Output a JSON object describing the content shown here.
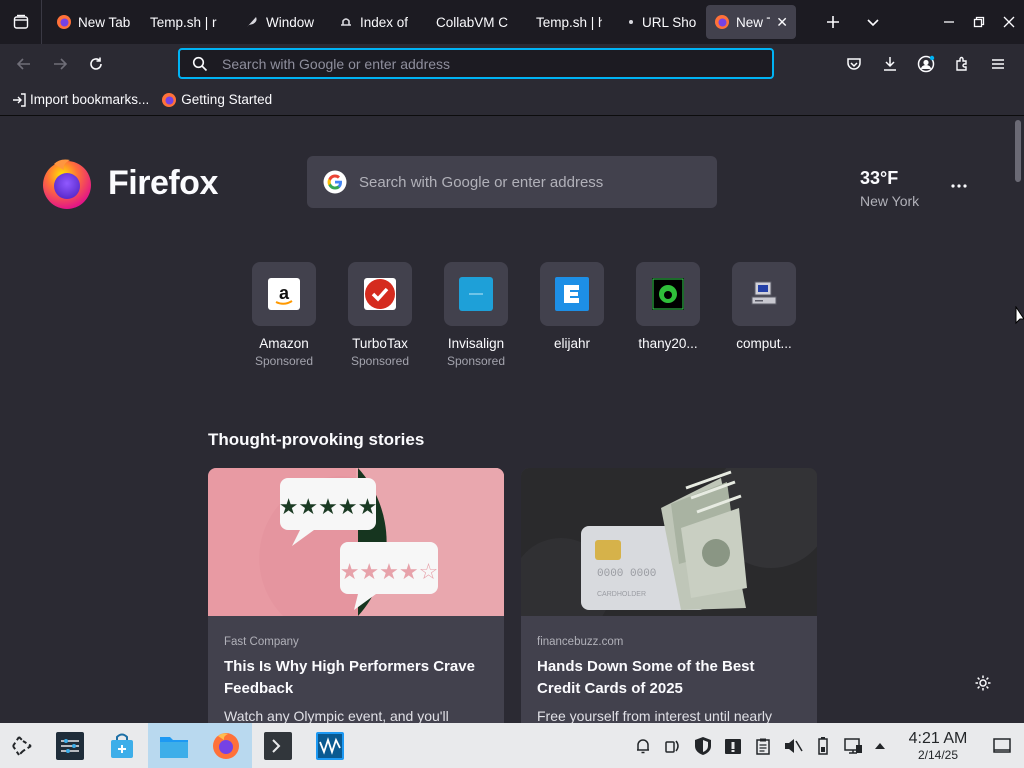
{
  "window": {
    "tabs": [
      {
        "label": "New Tab",
        "icon": "firefox-icon",
        "active": false
      },
      {
        "label": "Temp.sh | r",
        "icon": "none",
        "active": false
      },
      {
        "label": "Window",
        "icon": "feather-icon",
        "active": false
      },
      {
        "label": "Index of",
        "icon": "hat-icon",
        "active": false
      },
      {
        "label": "CollabVM Cl",
        "icon": "none",
        "active": false
      },
      {
        "label": "Temp.sh | h",
        "icon": "none",
        "active": false
      },
      {
        "label": "URL Sho",
        "icon": "link-icon",
        "active": false
      },
      {
        "label": "New T",
        "icon": "firefox-icon",
        "active": true
      }
    ]
  },
  "navbar": {
    "url_placeholder": "Search with Google or enter address"
  },
  "bookmarks": {
    "items": [
      {
        "label": "Import bookmarks...",
        "icon": "import-icon"
      },
      {
        "label": "Getting Started",
        "icon": "firefox-icon"
      }
    ]
  },
  "newtab": {
    "brand": "Firefox",
    "search_placeholder": "Search with Google or enter address",
    "weather": {
      "temp": "33°F",
      "city": "New York"
    },
    "top_sites": [
      {
        "name": "Amazon",
        "sponsor": "Sponsored",
        "icon": "amazon-icon"
      },
      {
        "name": "TurboTax",
        "sponsor": "Sponsored",
        "icon": "turbotax-icon"
      },
      {
        "name": "Invisalign",
        "sponsor": "Sponsored",
        "icon": "invisalign-icon"
      },
      {
        "name": "elijahr",
        "sponsor": "",
        "icon": "elijahr-icon"
      },
      {
        "name": "thany20...",
        "sponsor": "",
        "icon": "green-eye-icon"
      },
      {
        "name": "comput...",
        "sponsor": "",
        "icon": "computer-icon"
      }
    ],
    "section_title": "Thought-provoking stories",
    "stories": [
      {
        "source": "Fast Company",
        "title_line1": "This Is Why High Performers Crave",
        "title_line2": "Feedback",
        "excerpt": "Watch any Olympic event, and you'll",
        "image": "rating-speech-bubbles"
      },
      {
        "source": "financebuzz.com",
        "title_line1": "Hands Down Some of the Best",
        "title_line2": "Credit Cards of 2025",
        "excerpt": "Free yourself from interest until nearly",
        "image": "credit-card-cash"
      }
    ]
  },
  "taskbar": {
    "time": "4:21 AM",
    "date": "2/14/25"
  },
  "colors": {
    "accent": "#00b3f4",
    "background": "#2b2a33",
    "tile": "#42414d",
    "taskbar": "#e9eaec"
  }
}
